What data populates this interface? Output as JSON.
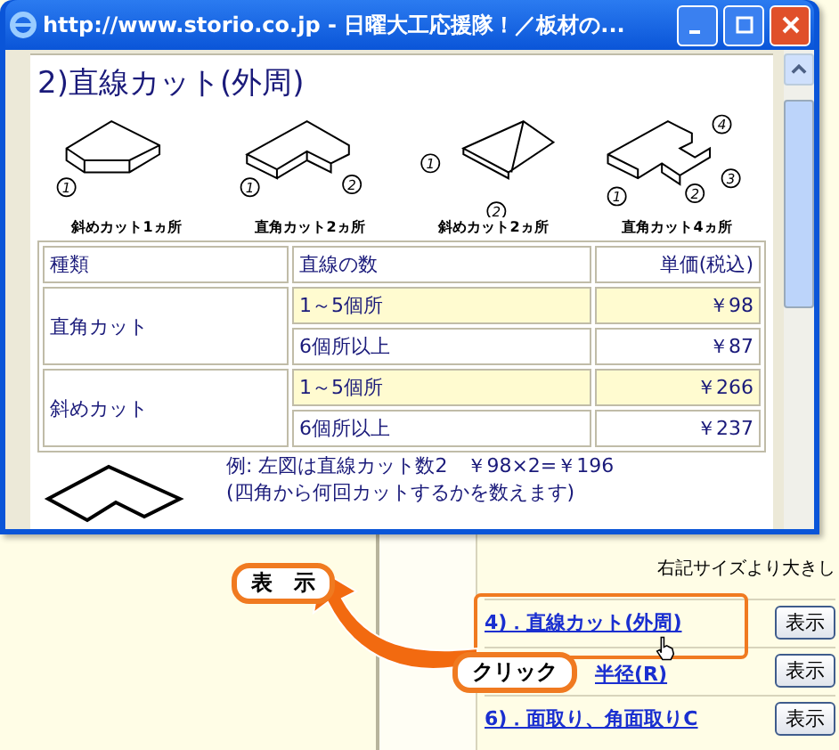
{
  "window": {
    "title": "http://www.storio.co.jp - 日曜大工応援隊！／板材の..."
  },
  "popup": {
    "heading": "2)直線カット(外周)",
    "diagrams": [
      {
        "kind": "diagonal1",
        "caption": "斜めカット1ヵ所",
        "markers": [
          "1"
        ]
      },
      {
        "kind": "right2",
        "caption": "直角カット2ヵ所",
        "markers": [
          "1",
          "2"
        ]
      },
      {
        "kind": "diagonal2",
        "caption": "斜めカット2ヵ所",
        "markers": [
          "1",
          "2"
        ]
      },
      {
        "kind": "right4",
        "caption": "直角カット4ヵ所",
        "markers": [
          "1",
          "2",
          "3",
          "4"
        ]
      }
    ],
    "table": {
      "columns": [
        "種類",
        "直線の数",
        "単価(税込)"
      ],
      "groups": [
        {
          "type": "直角カット",
          "rows": [
            {
              "count": "1～5個所",
              "price": "￥98",
              "highlighted": true
            },
            {
              "count": "6個所以上",
              "price": "￥87",
              "highlighted": false
            }
          ]
        },
        {
          "type": "斜めカット",
          "rows": [
            {
              "count": "1～5個所",
              "price": "￥266",
              "highlighted": true
            },
            {
              "count": "6個所以上",
              "price": "￥237",
              "highlighted": false
            }
          ]
        }
      ]
    },
    "example": [
      "例: 左図は直線カット数2　￥98×2=￥196",
      "(四角から何回カットするかを数えます)"
    ]
  },
  "page": {
    "note": "右記サイズより大きし",
    "links": [
      {
        "label": "4)．直線カット(外周)",
        "button": "表示"
      },
      {
        "label": "半径(R)",
        "button": "表示"
      },
      {
        "label": "6)．面取り、角面取りC",
        "button": "表示"
      }
    ]
  },
  "callouts": {
    "show": "表　示",
    "click": "クリック"
  }
}
